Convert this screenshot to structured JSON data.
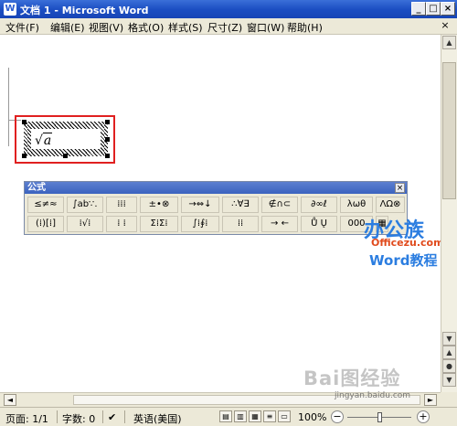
{
  "window": {
    "title": "文档 1 - Microsoft Word",
    "minimize": "_",
    "maximize": "□",
    "close": "×"
  },
  "menu": {
    "items": [
      "文件(F)",
      "编辑(E)",
      "视图(V)",
      "格式(O)",
      "样式(S)",
      "尺寸(Z)",
      "窗口(W)",
      "帮助(H)"
    ],
    "close": "×"
  },
  "equation": {
    "radical": "√",
    "radicand": "a"
  },
  "equation_toolbar": {
    "title": "公式",
    "close": "×",
    "row1": [
      "≤≠≈",
      "∫ab∵.",
      "⁞⁞⁞",
      "±•⊗",
      "→⇔↓",
      "∴∀∃",
      "∉∩⊂",
      "∂∞ℓ",
      "λωθ",
      "ΛΩ⊗"
    ],
    "row2": [
      "(⁞)[⁞]",
      "⁞√⁞",
      "Σ⁞Σ⁞",
      "∫⁞∮⁞",
      "⁞⁞",
      "→ ←",
      "Ů Ų",
      "000",
      "▦"
    ]
  },
  "status": {
    "page": "页面: 1/1",
    "words": "字数: 0",
    "language": "英语(美国)",
    "zoom": "100%"
  },
  "watermark": {
    "brand": "办公族",
    "site": "Officezu.com",
    "tag": "Word教程",
    "baidu": "Bai图经验",
    "url": "jingyan.baidu.com"
  }
}
